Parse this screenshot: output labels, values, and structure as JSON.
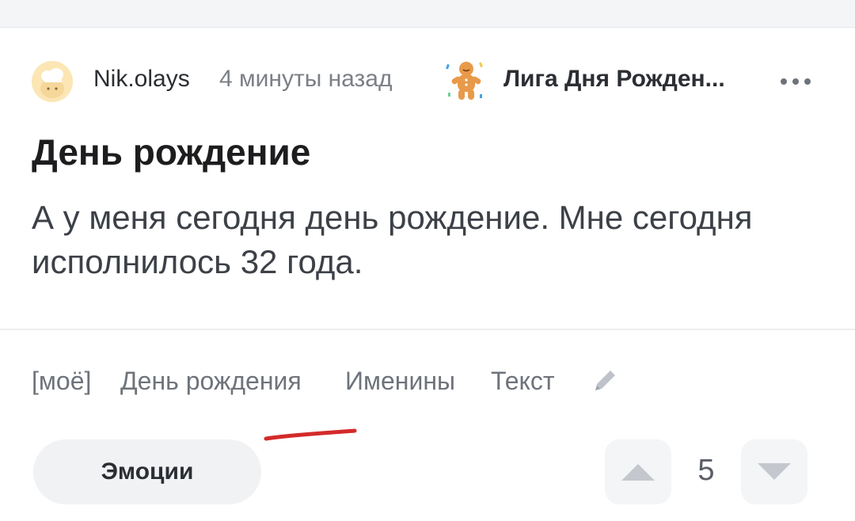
{
  "author": {
    "name": "Nik.olays",
    "avatar_icon": "chef-hat-avatar-icon"
  },
  "post": {
    "time": "4 минуты назад",
    "community": "Лига Дня Рожден...",
    "community_icon": "gingerbread-man-icon",
    "title": "День рождение",
    "body": "А у меня сегодня день рождение. Мне сегодня исполнилось 32 года."
  },
  "tags": [
    {
      "label": "[моё]"
    },
    {
      "label": "День рождения"
    },
    {
      "label": "Именины"
    },
    {
      "label": "Текст"
    }
  ],
  "actions": {
    "emotions_label": "Эмоции",
    "rating": "5"
  },
  "colors": {
    "underline_annotation": "#d42a2a",
    "vote_arrow": "#c4c8ce"
  }
}
